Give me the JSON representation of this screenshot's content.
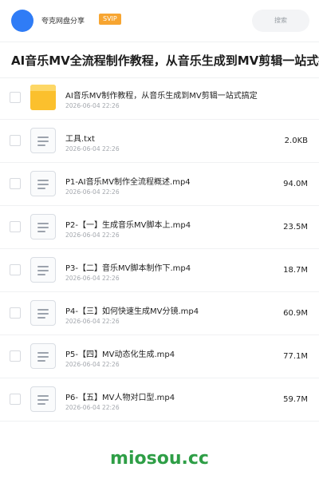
{
  "header": {
    "app_name": "夸克网盘分享",
    "badge": "SVIP",
    "search_placeholder": "搜索"
  },
  "page": {
    "title": "AI音乐MV全流程制作教程，从音乐生成到MV剪辑一站式搞定"
  },
  "files": [
    {
      "name": "AI音乐MV制作教程，从音乐生成到MV剪辑一站式搞定",
      "date": "2026-06-04 22:26",
      "size": "",
      "type": "folder"
    },
    {
      "name": "工具.txt",
      "date": "2026-06-04 22:26",
      "size": "2.0KB",
      "type": "file"
    },
    {
      "name": "P1-AI音乐MV制作全流程概述.mp4",
      "date": "2026-06-04 22:26",
      "size": "94.0M",
      "type": "file"
    },
    {
      "name": "P2-【一】生成音乐MV脚本上.mp4",
      "date": "2026-06-04 22:26",
      "size": "23.5M",
      "type": "file"
    },
    {
      "name": "P3-【二】音乐MV脚本制作下.mp4",
      "date": "2026-06-04 22:26",
      "size": "18.7M",
      "type": "file"
    },
    {
      "name": "P4-【三】如何快速生成MV分镜.mp4",
      "date": "2026-06-04 22:26",
      "size": "60.9M",
      "type": "file"
    },
    {
      "name": "P5-【四】MV动态化生成.mp4",
      "date": "2026-06-04 22:26",
      "size": "77.1M",
      "type": "file"
    },
    {
      "name": "P6-【五】MV人物对口型.mp4",
      "date": "2026-06-04 22:26",
      "size": "59.7M",
      "type": "file"
    }
  ],
  "watermark": "miosou.cc",
  "colors": {
    "accent": "#2f7cf6",
    "badge": "#f7a531",
    "folder": "#fbc02d",
    "watermark": "#2e9e46"
  }
}
